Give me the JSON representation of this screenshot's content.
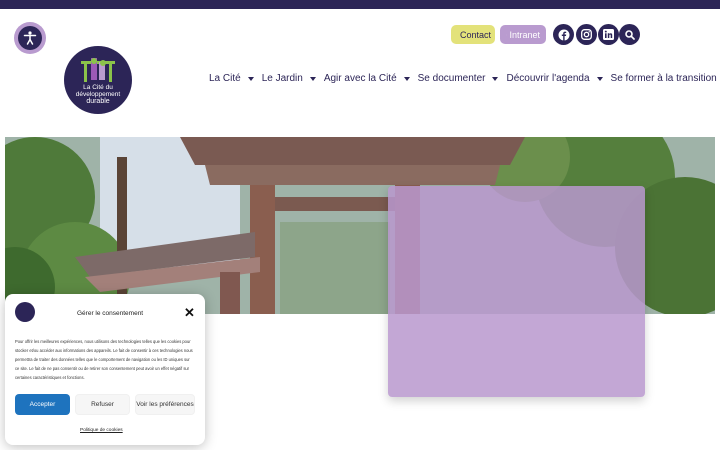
{
  "header": {
    "logo": {
      "line1": "La Cité du",
      "line2": "développement",
      "line3": "durable"
    },
    "contact_label": "Contact",
    "intranet_label": "Intranet",
    "social": [
      "facebook-icon",
      "instagram-icon",
      "linkedin-icon",
      "search-icon"
    ]
  },
  "nav": {
    "items": [
      {
        "label": "La Cité"
      },
      {
        "label": "Le Jardin"
      },
      {
        "label": "Agir avec la Cité"
      },
      {
        "label": "Se documenter"
      },
      {
        "label": "Découvrir l'agenda"
      },
      {
        "label": "Se former à la transition"
      }
    ]
  },
  "consent": {
    "title": "Gérer le consentement",
    "body": "Pour offrir les meilleures expériences, nous utilisons des technologies telles que les cookies pour stocker et/ou accéder aux informations des appareils. Le fait de consentir à ces technologies nous permettra de traiter des données telles que le comportement de navigation ou les ID uniques sur ce site. Le fait de ne pas consentir ou de retirer son consentement peut avoir un effet négatif sur certaines caractéristiques et fonctions.",
    "accept_label": "Accepter",
    "refuse_label": "Refuser",
    "prefs_label": "Voir les préférences",
    "policy_label": "Politique de cookies"
  },
  "colors": {
    "primary": "#2c2557",
    "lilac": "#b99bcf",
    "yellow": "#e3e27a",
    "accept_blue": "#1e73be"
  }
}
